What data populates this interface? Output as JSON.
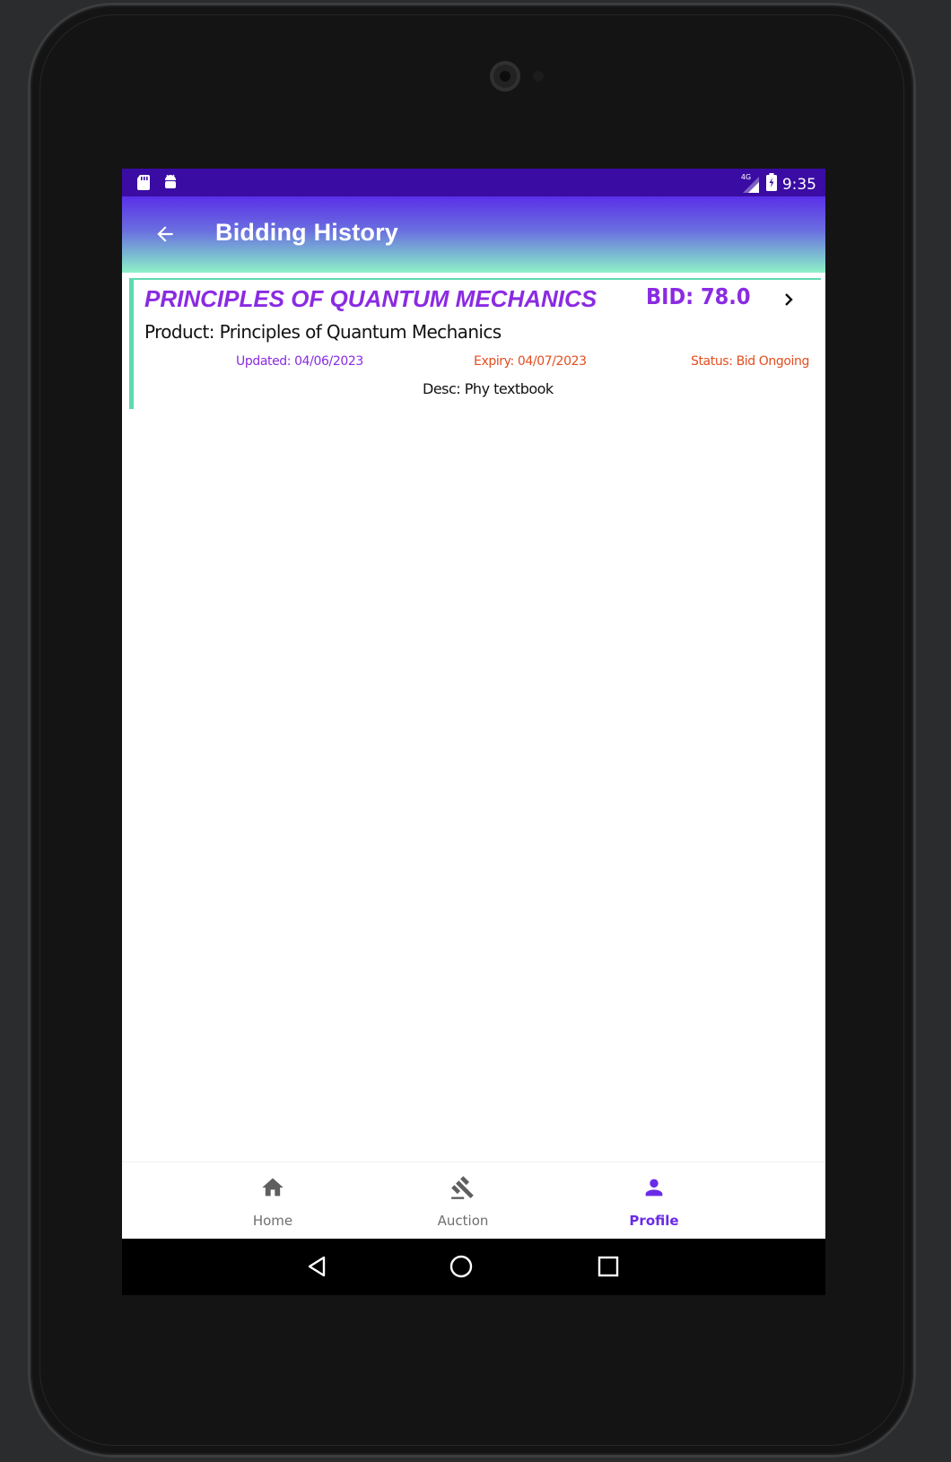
{
  "status_bar": {
    "time": "9:35",
    "network_badge": "4G",
    "icons": [
      "sd-card-icon",
      "android-icon",
      "signal-icon",
      "battery-icon"
    ]
  },
  "app_bar": {
    "title": "Bidding History",
    "back_icon": "arrow-back-icon"
  },
  "bids": [
    {
      "title": "PRINCIPLES OF QUANTUM MECHANICS",
      "bid": "BID: 78.0",
      "product": "Product: Principles of Quantum Mechanics",
      "updated": "Updated: 04/06/2023",
      "expiry": "Expiry: 04/07/2023",
      "status": "Status: Bid Ongoing",
      "desc": "Desc: Phy textbook",
      "chevron_icon": "chevron-right-icon"
    }
  ],
  "bottom_nav": {
    "items": [
      {
        "label": "Home",
        "icon": "home-icon",
        "active": false
      },
      {
        "label": "Auction",
        "icon": "gavel-icon",
        "active": false
      },
      {
        "label": "Profile",
        "icon": "person-icon",
        "active": true
      }
    ]
  },
  "system_nav": {
    "buttons": [
      "back-triangle-icon",
      "home-circle-icon",
      "recents-square-icon"
    ]
  },
  "colors": {
    "status_bar": "#3a0ca3",
    "accent_purple": "#8a2be2",
    "accent_orange": "#e34d1f",
    "card_border": "#5fd9b0",
    "nav_active": "#6a2be8"
  }
}
